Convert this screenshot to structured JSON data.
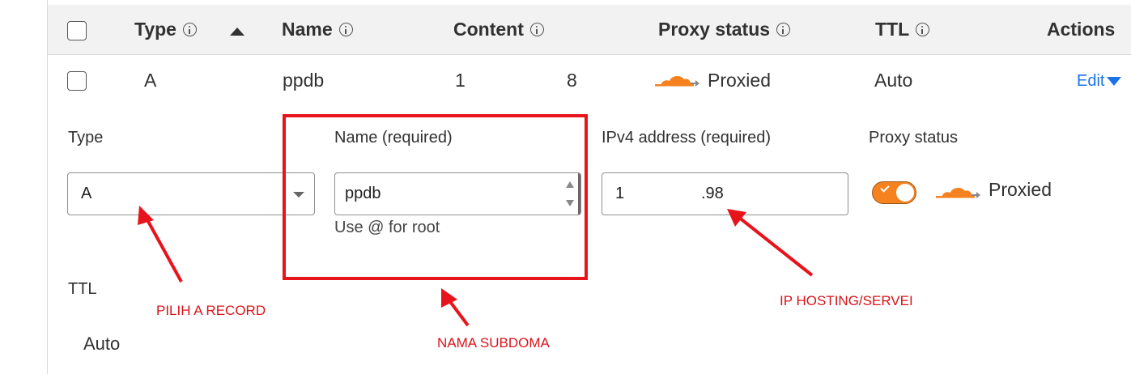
{
  "table": {
    "headers": {
      "type": "Type",
      "name": "Name",
      "content": "Content",
      "proxy_status": "Proxy status",
      "ttl": "TTL",
      "actions": "Actions"
    },
    "row": {
      "type": "A",
      "name": "ppdb",
      "content_start": "1",
      "content_end": "8",
      "proxy_status": "Proxied",
      "ttl": "Auto",
      "edit": "Edit"
    }
  },
  "form": {
    "type_label": "Type",
    "type_value": "A",
    "name_label": "Name (required)",
    "name_value": "ppdb",
    "name_help": "Use @ for root",
    "ipv4_label": "IPv4 address (required)",
    "ipv4_start": "1",
    "ipv4_end": ".98",
    "proxy_label": "Proxy status",
    "proxy_value": "Proxied",
    "proxy_enabled": true,
    "ttl_label": "TTL",
    "ttl_value": "Auto"
  },
  "annotations": {
    "type": "PILIH A RECORD",
    "name": "NAMA SUBDOMA",
    "ip": "IP HOSTING/SERVEI"
  },
  "colors": {
    "accent": "#1a73e8",
    "cloudflare_orange": "#f6821f",
    "annotation_red": "#e8141b"
  },
  "icons": [
    "info-icon",
    "sort-ascending-icon",
    "proxied-cloud-icon",
    "chevron-down-icon",
    "checkbox-icon",
    "toggle-check-icon",
    "annotation-arrow-icon"
  ]
}
